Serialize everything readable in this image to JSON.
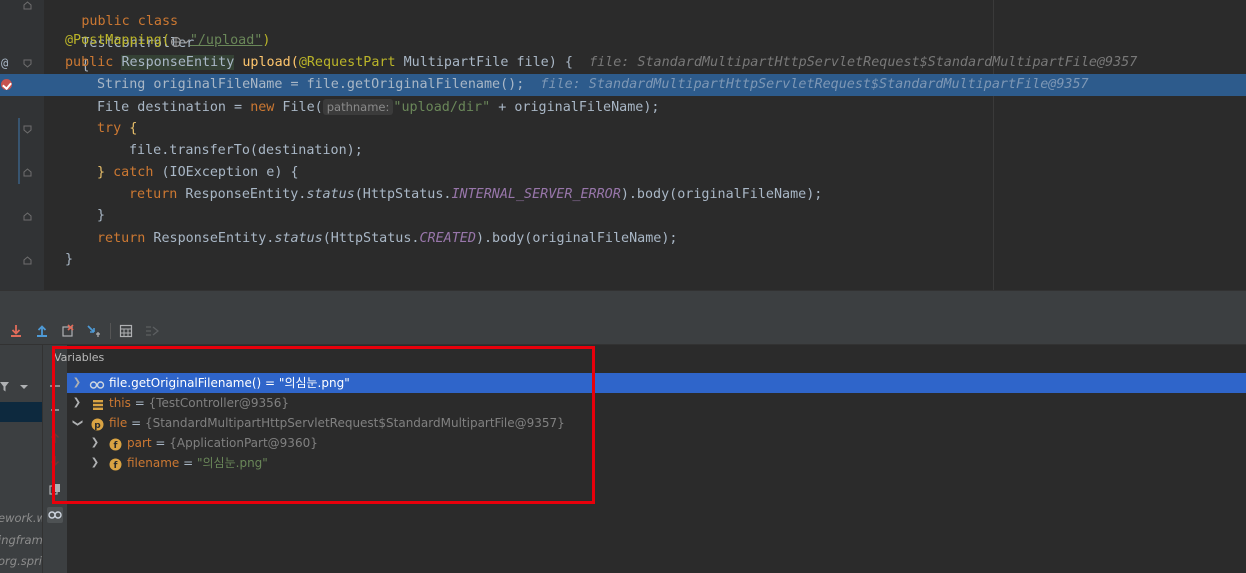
{
  "editor": {
    "line_top_partial": {
      "kw": "public class",
      "name": "TestController",
      "brace": "{"
    },
    "annotation": "@PostMapping(",
    "annotation_path": "\"/upload\"",
    "annotation_close": ")",
    "method_kw": "public",
    "method_return": "ResponseEntity",
    "method_name": "upload(",
    "method_param_ann": "@RequestPart",
    "method_params": " MultipartFile file) {",
    "method_hint": "file: StandardMultipartHttpServletRequest$StandardMultipartFile@9357",
    "exec_line": "String originalFileName = file.getOriginalFilename();",
    "exec_hint": "file: StandardMultipartHttpServletRequest$StandardMultipartFile@9357",
    "dest_type": "File destination = ",
    "dest_new": "new",
    "dest_ctor": " File(",
    "dest_param_hint": "pathname:",
    "dest_str": "\"upload/dir\"",
    "dest_rest": " + originalFileName);",
    "try_kw": "try",
    "try_brace": " {",
    "transfer": "file.transferTo(destination);",
    "catch_close": "}",
    "catch_kw": " catch",
    "catch_rest": " (IOException e) {",
    "ret1_kw": "return",
    "ret1_a": " ResponseEntity.",
    "ret1_status": "status",
    "ret1_b": "(HttpStatus.",
    "ret1_const": "INTERNAL_SERVER_ERROR",
    "ret1_c": ").body(originalFileName);",
    "close_inner": "}",
    "ret2_kw": "return",
    "ret2_a": " ResponseEntity.",
    "ret2_status": "status",
    "ret2_b": "(HttpStatus.",
    "ret2_const": "CREATED",
    "ret2_c": ").body(originalFileName);",
    "close_method": "}"
  },
  "gutter": {
    "at_symbol": "@"
  },
  "debugger": {
    "panel_title": "Variables",
    "variables": [
      {
        "name": "file.getOriginalFilename()",
        "eq": " = ",
        "value": "\"의심눈.png\"",
        "icon": "watch-icon",
        "expanded": false,
        "selected": true
      },
      {
        "name": "this",
        "eq": " = ",
        "value": "{TestController@9356}",
        "icon": "object-icon",
        "expanded": false,
        "selected": false
      },
      {
        "name": "file",
        "eq": " = ",
        "value": "{StandardMultipartHttpServletRequest$StandardMultipartFile@9357}",
        "icon": "parameter-icon",
        "expanded": true,
        "selected": false
      },
      {
        "name": "part",
        "eq": " = ",
        "value": "{ApplicationPart@9360}",
        "icon": "field-icon",
        "expanded": false,
        "selected": false
      },
      {
        "name": "filename",
        "eq": " = ",
        "value": "\"의심눈.png\"",
        "icon": "field-icon",
        "expanded": false,
        "selected": false
      }
    ]
  },
  "frames": {
    "partial_texts": [
      "ework.w",
      "ingfram",
      "org.spri"
    ]
  },
  "colors": {
    "highlight": "#e8000b",
    "selection": "#2f65ca",
    "exec_line": "#2d5b8c"
  }
}
